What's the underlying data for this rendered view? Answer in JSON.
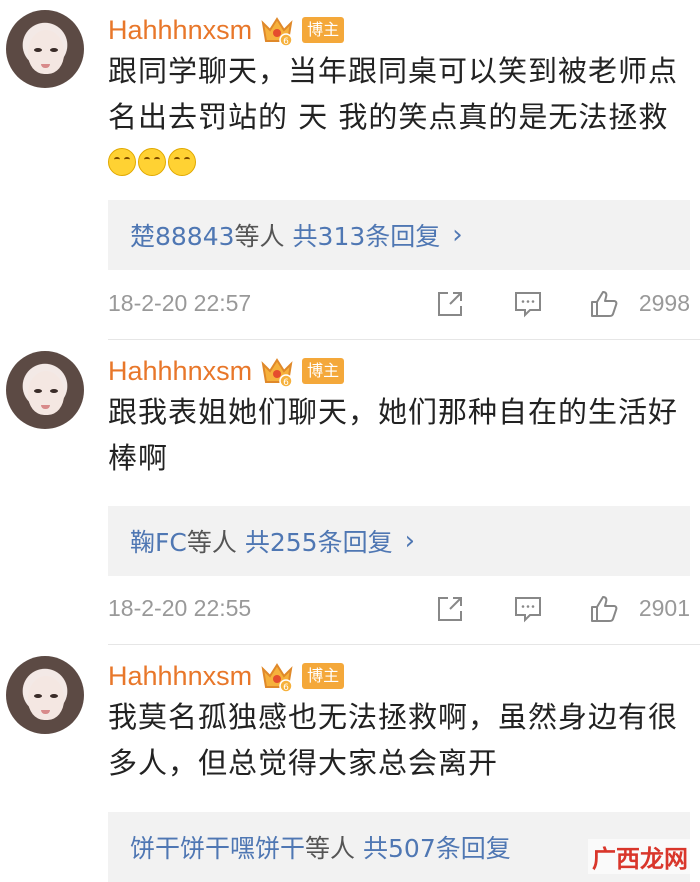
{
  "comments": [
    {
      "username": "Hahhhnxsm",
      "badge": "博主",
      "text": "跟同学聊天，当年跟同桌可以笑到被老师点名出去罚站的  天 我的笑点真的是无法拯救",
      "emoji_count": 3,
      "reply_names": "楚88843",
      "reply_mid": "等人",
      "reply_count": "共313条回复",
      "timestamp": "18-2-20 22:57",
      "likes": "2998"
    },
    {
      "username": "Hahhhnxsm",
      "badge": "博主",
      "text": "跟我表姐她们聊天，她们那种自在的生活好棒啊",
      "reply_names": "鞠FC",
      "reply_mid": "等人",
      "reply_count": "共255条回复",
      "timestamp": "18-2-20 22:55",
      "likes": "2901"
    },
    {
      "username": "Hahhhnxsm",
      "badge": "博主",
      "text": "我莫名孤独感也无法拯救啊，虽然身边有很多人，但总觉得大家总会离开",
      "reply_names": "饼干饼干嘿饼干",
      "reply_mid": "等人",
      "reply_count": "共507条回复"
    }
  ],
  "watermark": "广西龙网",
  "icons": {
    "share": "share-icon",
    "comment": "comment-icon",
    "like": "thumbs-up-icon",
    "crown": "crown-icon",
    "emoji": "laugh-cry-emoji"
  },
  "colors": {
    "username": "#e8772a",
    "badge_bg": "#f4a83a",
    "link": "#4f77b3",
    "meta": "#999999"
  }
}
